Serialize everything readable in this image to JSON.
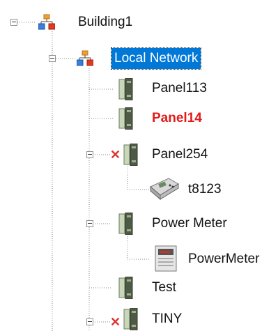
{
  "tree": {
    "nodes": [
      {
        "id": "building1",
        "label": "Building1",
        "icon": "network-icon",
        "state": "expanded"
      },
      {
        "id": "local-network",
        "label": "Local Network",
        "icon": "network-icon",
        "state": "expanded",
        "selected": true
      },
      {
        "id": "panel113",
        "label": "Panel113",
        "icon": "panel-icon"
      },
      {
        "id": "panel14",
        "label": "Panel14",
        "icon": "panel-icon",
        "color": "#e31b1b"
      },
      {
        "id": "panel254",
        "label": "Panel254",
        "icon": "panel-icon",
        "state": "expanded",
        "status": "offline"
      },
      {
        "id": "t8123",
        "label": "t8123",
        "icon": "device-icon"
      },
      {
        "id": "power-meter",
        "label": "Power Meter",
        "icon": "panel-icon",
        "state": "expanded"
      },
      {
        "id": "powermeter",
        "label": "PowerMeter",
        "icon": "meter-icon"
      },
      {
        "id": "test",
        "label": "Test",
        "icon": "panel-icon"
      },
      {
        "id": "tiny",
        "label": "TINY",
        "icon": "panel-icon",
        "state": "expanded",
        "status": "offline"
      }
    ]
  }
}
